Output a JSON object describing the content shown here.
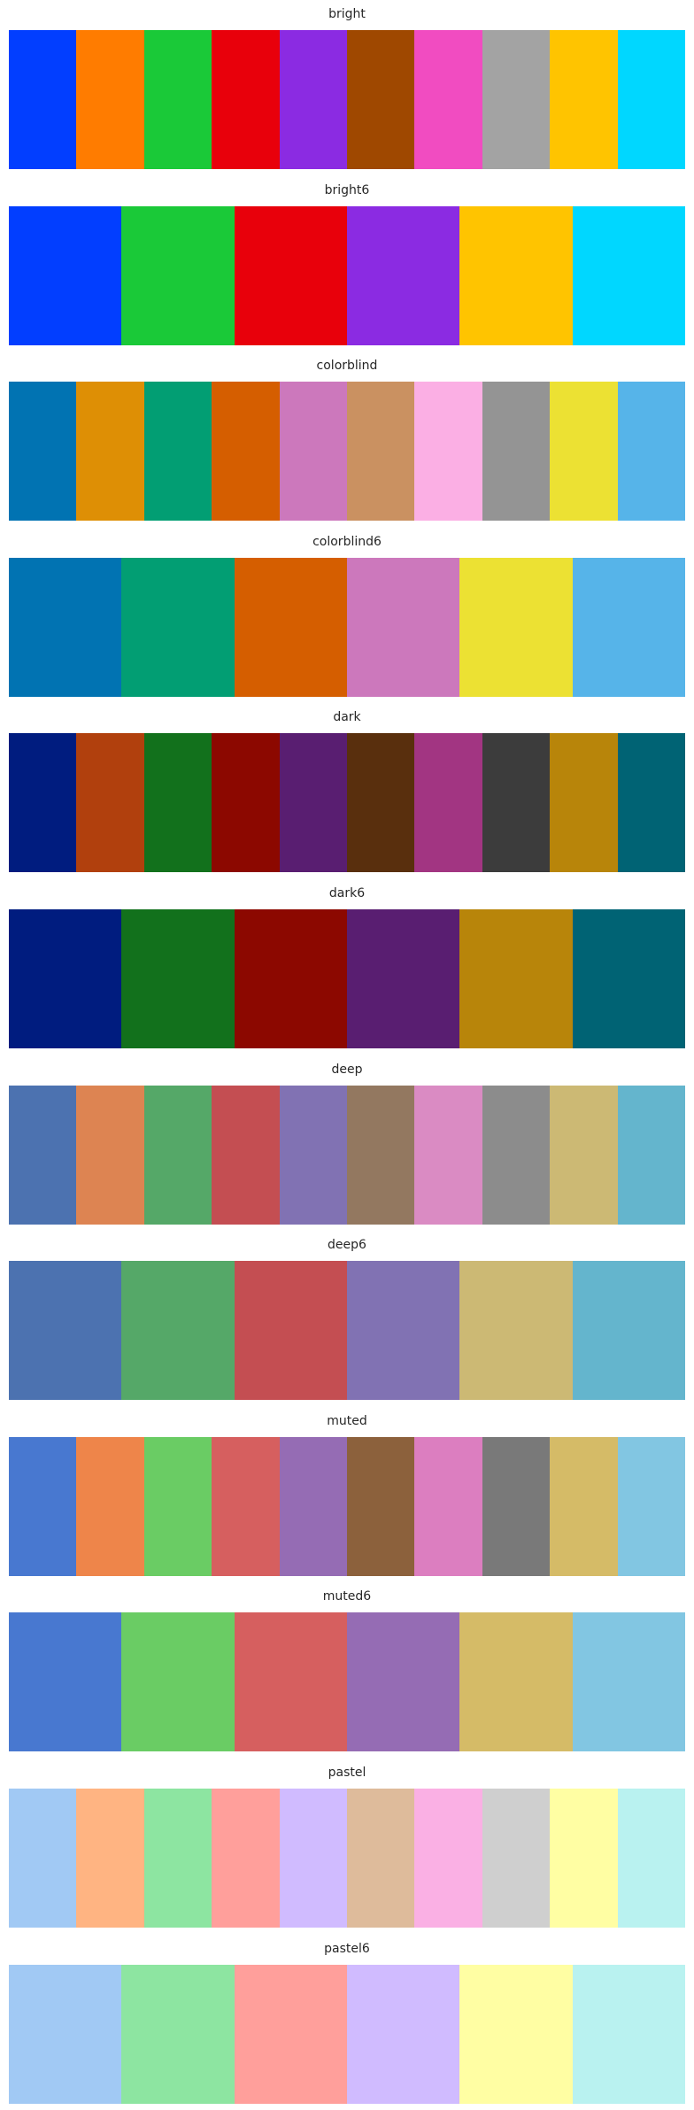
{
  "chart_data": [
    {
      "type": "bar",
      "title": "bright",
      "colors": [
        "#023eff",
        "#ff7c00",
        "#1ac938",
        "#e8000b",
        "#8b2be2",
        "#9f4800",
        "#f14cc1",
        "#a3a3a3",
        "#ffc400",
        "#00d7ff"
      ]
    },
    {
      "type": "bar",
      "title": "bright6",
      "colors": [
        "#023eff",
        "#1ac938",
        "#e8000b",
        "#8b2be2",
        "#ffc400",
        "#00d7ff"
      ]
    },
    {
      "type": "bar",
      "title": "colorblind",
      "colors": [
        "#0173b2",
        "#de8f05",
        "#029e73",
        "#d55e00",
        "#cc78bc",
        "#ca9161",
        "#fbafe4",
        "#949494",
        "#ece133",
        "#56b4e9"
      ]
    },
    {
      "type": "bar",
      "title": "colorblind6",
      "colors": [
        "#0173b2",
        "#029e73",
        "#d55e00",
        "#cc78bc",
        "#ece133",
        "#56b4e9"
      ]
    },
    {
      "type": "bar",
      "title": "dark",
      "colors": [
        "#001c7f",
        "#b1400d",
        "#12711c",
        "#8c0800",
        "#591e71",
        "#592f0d",
        "#a23582",
        "#3c3c3c",
        "#b8850a",
        "#006374"
      ]
    },
    {
      "type": "bar",
      "title": "dark6",
      "colors": [
        "#001c7f",
        "#12711c",
        "#8c0800",
        "#591e71",
        "#b8850a",
        "#006374"
      ]
    },
    {
      "type": "bar",
      "title": "deep",
      "colors": [
        "#4c72b0",
        "#dd8452",
        "#55a868",
        "#c44e52",
        "#8172b3",
        "#937860",
        "#da8bc3",
        "#8c8c8c",
        "#ccb974",
        "#64b5cd"
      ]
    },
    {
      "type": "bar",
      "title": "deep6",
      "colors": [
        "#4c72b0",
        "#55a868",
        "#c44e52",
        "#8172b3",
        "#ccb974",
        "#64b5cd"
      ]
    },
    {
      "type": "bar",
      "title": "muted",
      "colors": [
        "#4878d0",
        "#ee854a",
        "#6acc64",
        "#d65f5f",
        "#956cb4",
        "#8c613c",
        "#dc7ec0",
        "#797979",
        "#d5bb67",
        "#82c6e2"
      ]
    },
    {
      "type": "bar",
      "title": "muted6",
      "colors": [
        "#4878d0",
        "#6acc64",
        "#d65f5f",
        "#956cb4",
        "#d5bb67",
        "#82c6e2"
      ]
    },
    {
      "type": "bar",
      "title": "pastel",
      "colors": [
        "#a1c9f4",
        "#ffb482",
        "#8de5a1",
        "#ff9f9b",
        "#d0bbff",
        "#debb9b",
        "#fab0e4",
        "#cfcfcf",
        "#fffea3",
        "#b9f2f0"
      ]
    },
    {
      "type": "bar",
      "title": "pastel6",
      "colors": [
        "#a1c9f4",
        "#8de5a1",
        "#ff9f9b",
        "#d0bbff",
        "#fffea3",
        "#b9f2f0"
      ]
    }
  ]
}
